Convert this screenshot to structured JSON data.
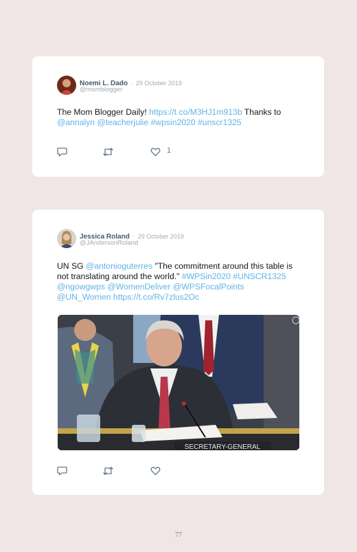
{
  "tweets": [
    {
      "name": "Noemi L. Dado",
      "separator": "·",
      "date": "29 October 2019",
      "handle": "@momblogger",
      "text_parts": {
        "p1": "The Mom Blogger Daily! ",
        "l1": "https://t.co/M3HJ1m913b",
        "p2": " Thanks to ",
        "l2": "@annalyn",
        "l3": "@teacherjulie",
        "l4": "#wpsin2020",
        "l5": "#unscr1325"
      },
      "like_count": "1"
    },
    {
      "name": "Jessica Roland",
      "separator": "·",
      "date": "29 October 2019",
      "handle": "@JAndersonRoland",
      "text_parts": {
        "p1": "UN SG ",
        "l1": "@antonioguterres",
        "p2": " \"The commitment around this table is not translating around the world.\" ",
        "l2": "#WPSin2020",
        "l3": "#UNSCR1325",
        "l4": "@ngowgwps",
        "l5": "@WomenDeliver",
        "l6": "@WPSFocalPoints",
        "l7": "@UN_Women",
        "l8": "https://t.co/Rv7zlus2Oc"
      },
      "photo_nameplate": "SECRETARY-GENERAL"
    }
  ],
  "page_number": "77",
  "colors": {
    "link": "#5fb4e6",
    "background": "#efe6e5",
    "card": "#ffffff"
  },
  "icons": [
    "reply-icon",
    "retweet-icon",
    "like-icon"
  ]
}
